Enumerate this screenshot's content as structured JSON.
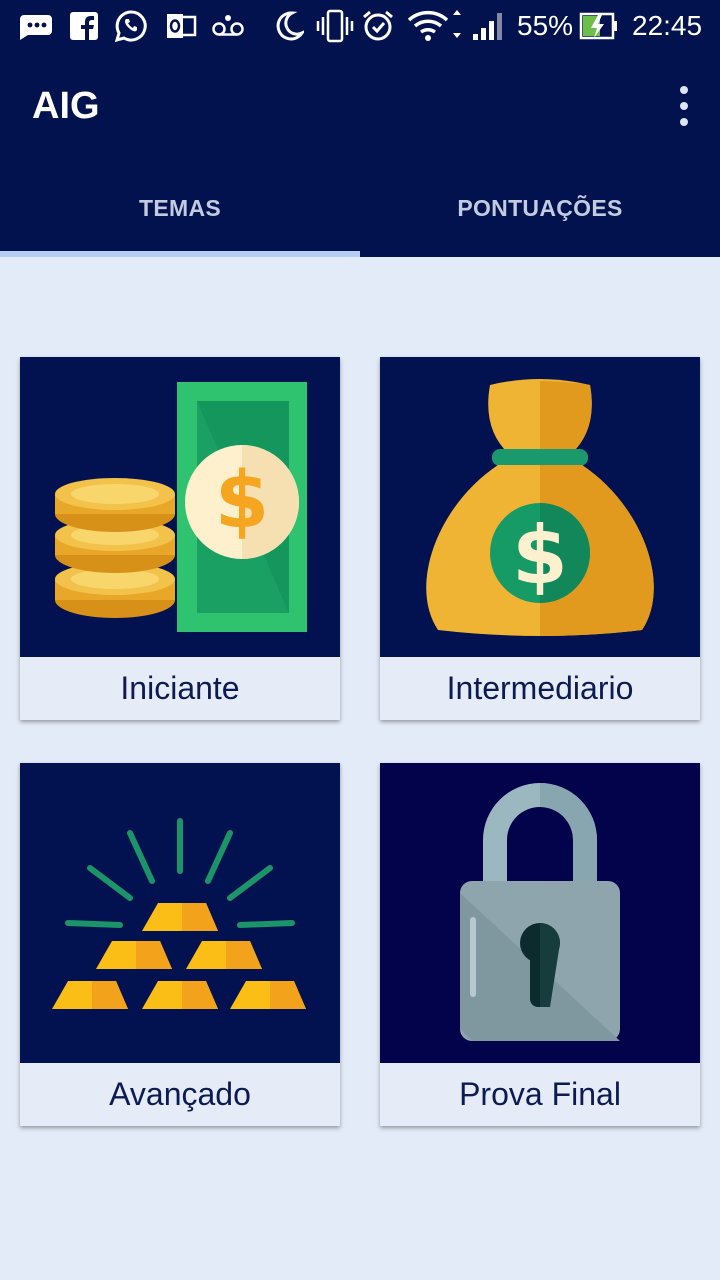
{
  "status_bar": {
    "battery": "55%",
    "time": "22:45",
    "icons": [
      "message-icon",
      "facebook-icon",
      "whatsapp-icon",
      "outlook-icon",
      "voicemail-icon",
      "moon-icon",
      "vibrate-icon",
      "alarm-icon",
      "wifi-icon",
      "signal-icon",
      "battery-charging-icon"
    ]
  },
  "appbar": {
    "title": "AIG",
    "menu_icon": "overflow-menu-icon"
  },
  "tabs": [
    {
      "label": "TEMAS",
      "selected": true
    },
    {
      "label": "PONTUAÇÕES",
      "selected": false
    }
  ],
  "themes": [
    {
      "label": "Iniciante",
      "icon": "cash-and-coins-icon"
    },
    {
      "label": "Intermediario",
      "icon": "money-bag-icon"
    },
    {
      "label": "Avançado",
      "icon": "gold-bars-icon"
    },
    {
      "label": "Prova Final",
      "icon": "padlock-icon"
    }
  ],
  "colors": {
    "primary": "#02124f",
    "background": "#e3ebf8",
    "tab_indicator": "#b7cdf2",
    "label_text": "#0c1b52"
  }
}
